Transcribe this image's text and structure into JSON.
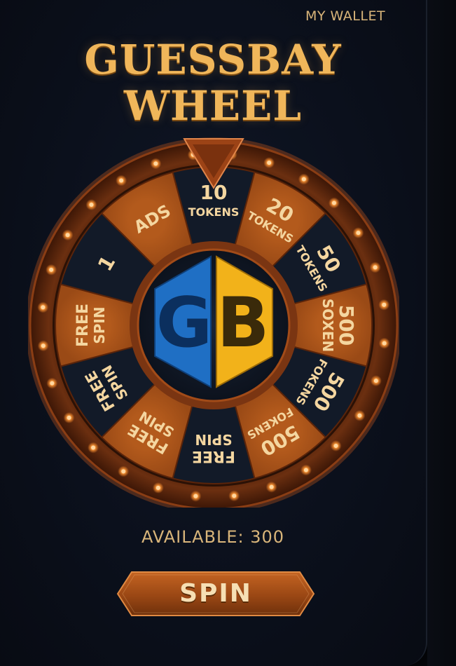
{
  "header": {
    "wallet_label": "MY WALLET",
    "title_line1": "GUESSBAY",
    "title_line2": "WHEEL"
  },
  "wheel": {
    "logo_letters": [
      "G",
      "B"
    ],
    "segments": [
      {
        "lines": [
          "10",
          "TOKENS"
        ],
        "theme": "dark"
      },
      {
        "lines": [
          "20",
          "TOKENS"
        ],
        "theme": "orange"
      },
      {
        "lines": [
          "50",
          "TOKENS"
        ],
        "theme": "dark"
      },
      {
        "lines": [
          "500",
          "SOXEN"
        ],
        "theme": "orange"
      },
      {
        "lines": [
          "500",
          "FOKENS"
        ],
        "theme": "dark"
      },
      {
        "lines": [
          "500",
          "FOKENS"
        ],
        "theme": "orange"
      },
      {
        "lines": [
          "FREE",
          "SPIN"
        ],
        "theme": "dark"
      },
      {
        "lines": [
          "FREE",
          "SPIN"
        ],
        "theme": "orange"
      },
      {
        "lines": [
          "FREE",
          "SPIN"
        ],
        "theme": "dark"
      },
      {
        "lines": [
          "FREE",
          "SPIN"
        ],
        "theme": "orange"
      },
      {
        "lines": [
          "1"
        ],
        "theme": "dark"
      },
      {
        "lines": [
          "ADS"
        ],
        "theme": "orange"
      }
    ],
    "colors": {
      "dark_segment": "#121a28",
      "orange_segment": "#9a4a16",
      "rim": "#6b2f10",
      "bulb": "#ff9a3a",
      "text": "#f4d6a0",
      "logo_blue": "#1f6fc4",
      "logo_yellow": "#f2b21a"
    }
  },
  "status": {
    "available_text": "AVAILABLE: 300"
  },
  "actions": {
    "spin_label": "SPIN"
  }
}
